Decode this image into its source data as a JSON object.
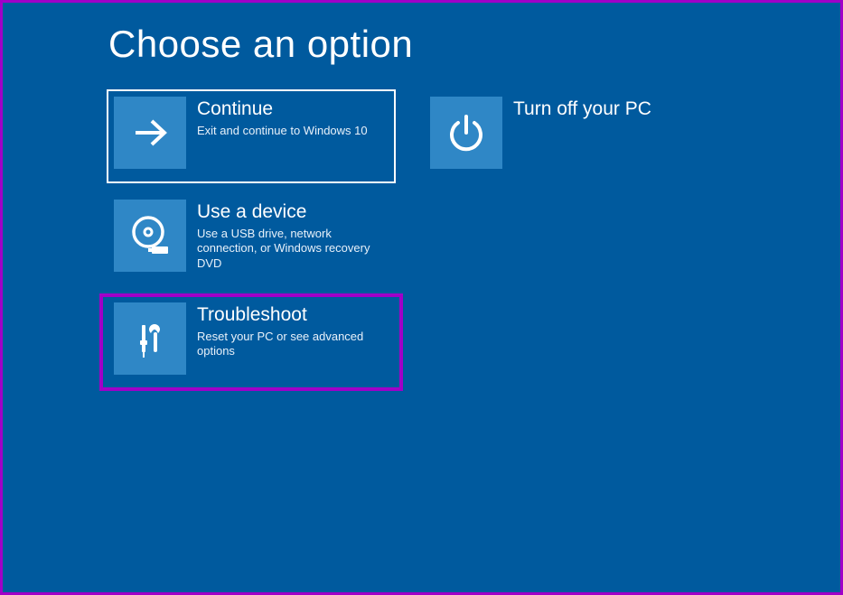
{
  "page": {
    "title": "Choose an option"
  },
  "tiles": {
    "continue": {
      "title": "Continue",
      "desc": "Exit and continue to Windows 10"
    },
    "use_device": {
      "title": "Use a device",
      "desc": "Use a USB drive, network connection, or Windows recovery DVD"
    },
    "troubleshoot": {
      "title": "Troubleshoot",
      "desc": "Reset your PC or see advanced options"
    },
    "turn_off": {
      "title": "Turn off your PC",
      "desc": ""
    }
  },
  "colors": {
    "background": "#005a9e",
    "tile_icon_bg": "#2f87c6",
    "highlight_border": "#a000c8",
    "selected_border": "#ffffff"
  }
}
